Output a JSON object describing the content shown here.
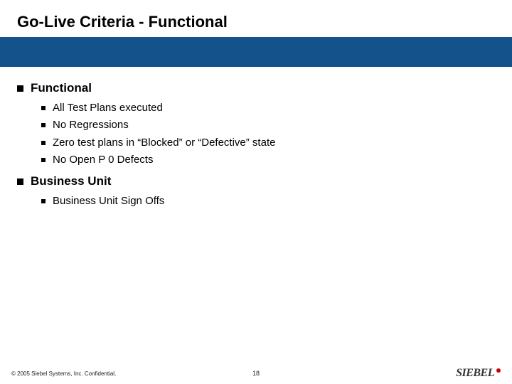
{
  "title": "Go-Live Criteria - Functional",
  "sections": [
    {
      "heading": "Functional",
      "items": [
        "All Test Plans executed",
        "No Regressions",
        "Zero test plans in “Blocked” or “Defective” state",
        "No Open P 0 Defects"
      ]
    },
    {
      "heading": "Business Unit",
      "items": [
        "Business Unit Sign Offs"
      ]
    }
  ],
  "footer": {
    "copyright": "© 2005 Siebel Systems, Inc. Confidential.",
    "page_number": "18",
    "logo_text": "SIEBEL"
  }
}
